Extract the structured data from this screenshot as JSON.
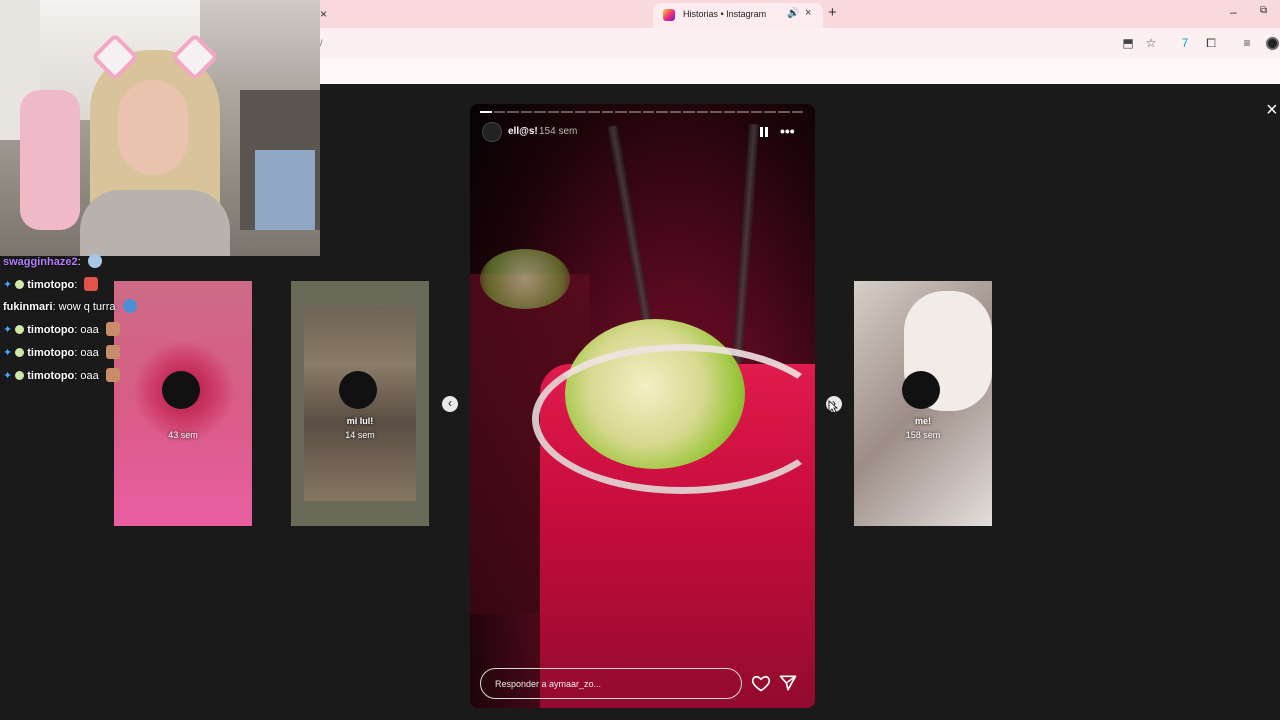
{
  "browser": {
    "prev_tab_close": "×",
    "tab": {
      "title": "Historias • Instagram",
      "audio_icon": "speaker-icon",
      "close": "×"
    },
    "new_tab": "+",
    "window": {
      "minimize": "–",
      "restore": "⧉"
    },
    "address_fragment": "/",
    "toolbar_icons": [
      "install-icon",
      "star-icon",
      "translate-icon",
      "extensions-icon",
      "media-icon",
      "profile-icon"
    ]
  },
  "chat": {
    "messages": [
      {
        "user": "swagginhaze2",
        "text": "",
        "user_color": "#b57cff"
      },
      {
        "user": "timotopo",
        "text": "",
        "user_color": "#ffffff"
      },
      {
        "user": "fukinmari",
        "text": "wow q turra",
        "user_color": "#ffffff"
      },
      {
        "user": "timotopo",
        "text": "oaa",
        "user_color": "#ffffff"
      },
      {
        "user": "timotopo",
        "text": "oaa",
        "user_color": "#ffffff"
      },
      {
        "user": "timotopo",
        "text": "oaa",
        "user_color": "#ffffff"
      }
    ],
    "colon": ":"
  },
  "previews": [
    {
      "name": "",
      "time": "43 sem"
    },
    {
      "name": "mi lul!",
      "time": "14 sem"
    },
    {
      "name": "me!",
      "time": "158 sem"
    }
  ],
  "story": {
    "username": "ell@s!",
    "time": "154 sem",
    "segments_total": 24,
    "segments_done": 1,
    "pause_icon": "pause-icon",
    "more_icon": "more-icon",
    "more_glyph": "•••",
    "reply_placeholder": "Responder a aymaar_zo...",
    "prev_arrow": "‹",
    "next_arrow": "›"
  },
  "viewer": {
    "close": "×"
  },
  "colors": {
    "accent": "#e01b4e",
    "tabbar": "#f8d9dc",
    "background": "#1a1a1a"
  }
}
